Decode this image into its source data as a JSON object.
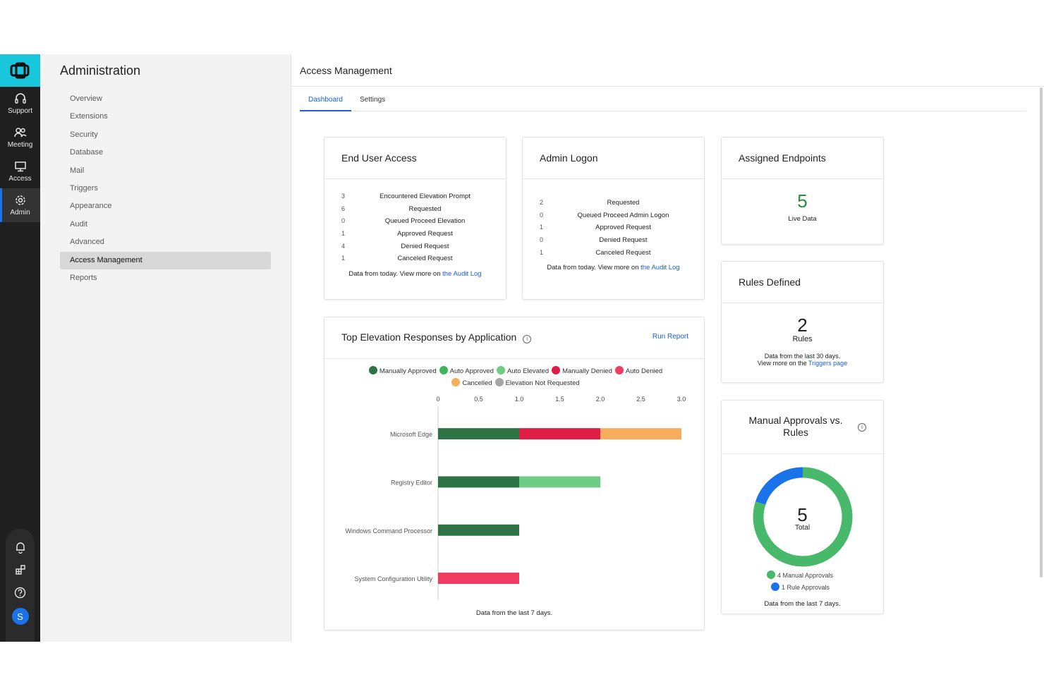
{
  "rail": {
    "items": [
      {
        "label": "Support"
      },
      {
        "label": "Meeting"
      },
      {
        "label": "Access"
      },
      {
        "label": "Admin"
      }
    ],
    "avatar": "S"
  },
  "admin": {
    "title": "Administration",
    "items": [
      "Overview",
      "Extensions",
      "Security",
      "Database",
      "Mail",
      "Triggers",
      "Appearance",
      "Audit",
      "Advanced",
      "Access Management",
      "Reports"
    ],
    "active": "Access Management"
  },
  "page": {
    "title": "Access Management",
    "tabs": [
      "Dashboard",
      "Settings"
    ]
  },
  "end_user_access": {
    "title": "End User Access",
    "rows": [
      {
        "count": "3",
        "label": "Encountered Elevation Prompt"
      },
      {
        "count": "6",
        "label": "Requested"
      },
      {
        "count": "0",
        "label": "Queued Proceed Elevation"
      },
      {
        "count": "1",
        "label": "Approved Request"
      },
      {
        "count": "4",
        "label": "Denied Request"
      },
      {
        "count": "1",
        "label": "Canceled Request"
      }
    ],
    "note": "Data from today. View more on ",
    "link": "the Audit Log"
  },
  "admin_logon": {
    "title": "Admin Logon",
    "rows": [
      {
        "count": "2",
        "label": "Requested"
      },
      {
        "count": "0",
        "label": "Queued Proceed Admin Logon"
      },
      {
        "count": "1",
        "label": "Approved Request"
      },
      {
        "count": "0",
        "label": "Denied Request"
      },
      {
        "count": "1",
        "label": "Canceled Request"
      }
    ],
    "note": "Data from today. View more on ",
    "link": "the Audit Log"
  },
  "assigned_endpoints": {
    "title": "Assigned Endpoints",
    "value": "5",
    "caption": "Live Data"
  },
  "rules_defined": {
    "title": "Rules Defined",
    "value": "2",
    "unit": "Rules",
    "note1": "Data from the last 30 days.",
    "note2": "View more on the ",
    "link": "Triggers page"
  },
  "manual_vs_rules": {
    "title_line1": "Manual Approvals vs.",
    "title_line2": "Rules",
    "total": "5",
    "total_label": "Total",
    "legend": [
      {
        "label": "4 Manual Approvals",
        "value": 4,
        "color": "#48b96a"
      },
      {
        "label": "1 Rule Approvals",
        "value": 1,
        "color": "#1a73e8"
      }
    ],
    "note": "Data from the last 7 days."
  },
  "top_elevation": {
    "title": "Top Elevation Responses by Application",
    "run_report": "Run Report",
    "note": "Data from the last 7 days."
  },
  "chart_data": {
    "type": "bar",
    "orientation": "horizontal",
    "stacked": true,
    "categories": [
      "Microsoft Edge",
      "Registry Editor",
      "Windows Command Processor",
      "System Configuration Utility"
    ],
    "x_ticks": [
      "0",
      "0.5",
      "1.0",
      "1.5",
      "2.0",
      "2.5",
      "3.0"
    ],
    "xlim": [
      0,
      3
    ],
    "grid": false,
    "legend_position": "top",
    "series": [
      {
        "name": "Manually Approved",
        "color": "#2d7345",
        "values": [
          1,
          1,
          1,
          0
        ]
      },
      {
        "name": "Auto Approved",
        "color": "#3fb45c",
        "values": [
          0,
          0,
          0,
          0
        ]
      },
      {
        "name": "Auto Elevated",
        "color": "#6fcc85",
        "values": [
          0,
          1,
          0,
          0
        ]
      },
      {
        "name": "Manually Denied",
        "color": "#dd1f47",
        "values": [
          1,
          0,
          0,
          0
        ]
      },
      {
        "name": "Auto Denied",
        "color": "#f13c62",
        "values": [
          0,
          0,
          0,
          1
        ]
      },
      {
        "name": "Cancelled",
        "color": "#f7ae5c",
        "values": [
          1,
          0,
          0,
          0
        ]
      },
      {
        "name": "Elevation Not Requested",
        "color": "#a6a6a6",
        "values": [
          0,
          0,
          0,
          0
        ]
      }
    ]
  }
}
